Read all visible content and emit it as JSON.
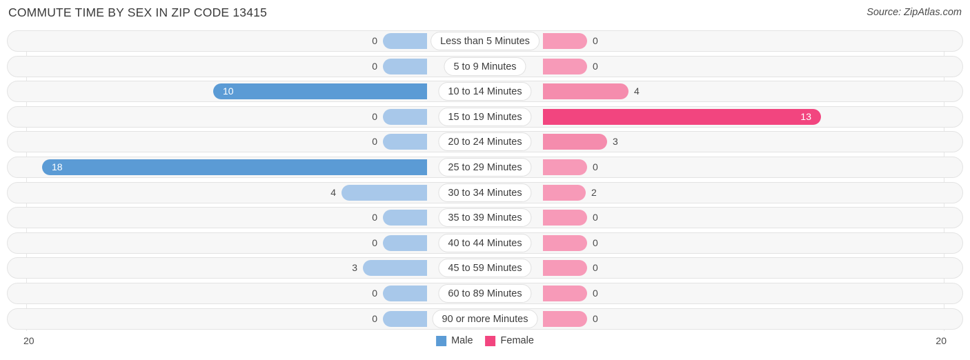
{
  "header": {
    "title": "COMMUTE TIME BY SEX IN ZIP CODE 13415",
    "source": "Source: ZipAtlas.com"
  },
  "axis": {
    "left_label": "20",
    "right_label": "20"
  },
  "legend": {
    "items": [
      {
        "label": "Male",
        "color": "#5b9bd5"
      },
      {
        "label": "Female",
        "color": "#f2457f"
      }
    ]
  },
  "chart_data": {
    "type": "bar",
    "subtype": "diverging-bidirectional",
    "title": "COMMUTE TIME BY SEX IN ZIP CODE 13415",
    "xlabel": "",
    "ylabel": "",
    "xlim": [
      20,
      20
    ],
    "axis_max": 20,
    "grid": true,
    "legend_position": "bottom-center",
    "categories": [
      "Less than 5 Minutes",
      "5 to 9 Minutes",
      "10 to 14 Minutes",
      "15 to 19 Minutes",
      "20 to 24 Minutes",
      "25 to 29 Minutes",
      "30 to 34 Minutes",
      "35 to 39 Minutes",
      "40 to 44 Minutes",
      "45 to 59 Minutes",
      "60 to 89 Minutes",
      "90 or more Minutes"
    ],
    "series": [
      {
        "name": "Male",
        "direction": "left",
        "color": "#5b9bd5",
        "values": [
          0,
          0,
          10,
          0,
          0,
          18,
          4,
          0,
          0,
          3,
          0,
          0
        ]
      },
      {
        "name": "Female",
        "direction": "right",
        "color": "#f2457f",
        "values": [
          0,
          0,
          4,
          13,
          3,
          0,
          2,
          0,
          0,
          0,
          0,
          0
        ]
      }
    ]
  },
  "rows": [
    {
      "category": "Less than 5 Minutes",
      "male": "0",
      "female": "0",
      "male_value": 0,
      "female_value": 0
    },
    {
      "category": "5 to 9 Minutes",
      "male": "0",
      "female": "0",
      "male_value": 0,
      "female_value": 0
    },
    {
      "category": "10 to 14 Minutes",
      "male": "10",
      "female": "4",
      "male_value": 10,
      "female_value": 4
    },
    {
      "category": "15 to 19 Minutes",
      "male": "0",
      "female": "13",
      "male_value": 0,
      "female_value": 13
    },
    {
      "category": "20 to 24 Minutes",
      "male": "0",
      "female": "3",
      "male_value": 0,
      "female_value": 3
    },
    {
      "category": "25 to 29 Minutes",
      "male": "18",
      "female": "0",
      "male_value": 18,
      "female_value": 0
    },
    {
      "category": "30 to 34 Minutes",
      "male": "4",
      "female": "2",
      "male_value": 4,
      "female_value": 2
    },
    {
      "category": "35 to 39 Minutes",
      "male": "0",
      "female": "0",
      "male_value": 0,
      "female_value": 0
    },
    {
      "category": "40 to 44 Minutes",
      "male": "0",
      "female": "0",
      "male_value": 0,
      "female_value": 0
    },
    {
      "category": "45 to 59 Minutes",
      "male": "3",
      "female": "0",
      "male_value": 3,
      "female_value": 0
    },
    {
      "category": "60 to 89 Minutes",
      "male": "0",
      "female": "0",
      "male_value": 0,
      "female_value": 0
    },
    {
      "category": "90 or more Minutes",
      "male": "0",
      "female": "0",
      "male_value": 0,
      "female_value": 0
    }
  ]
}
